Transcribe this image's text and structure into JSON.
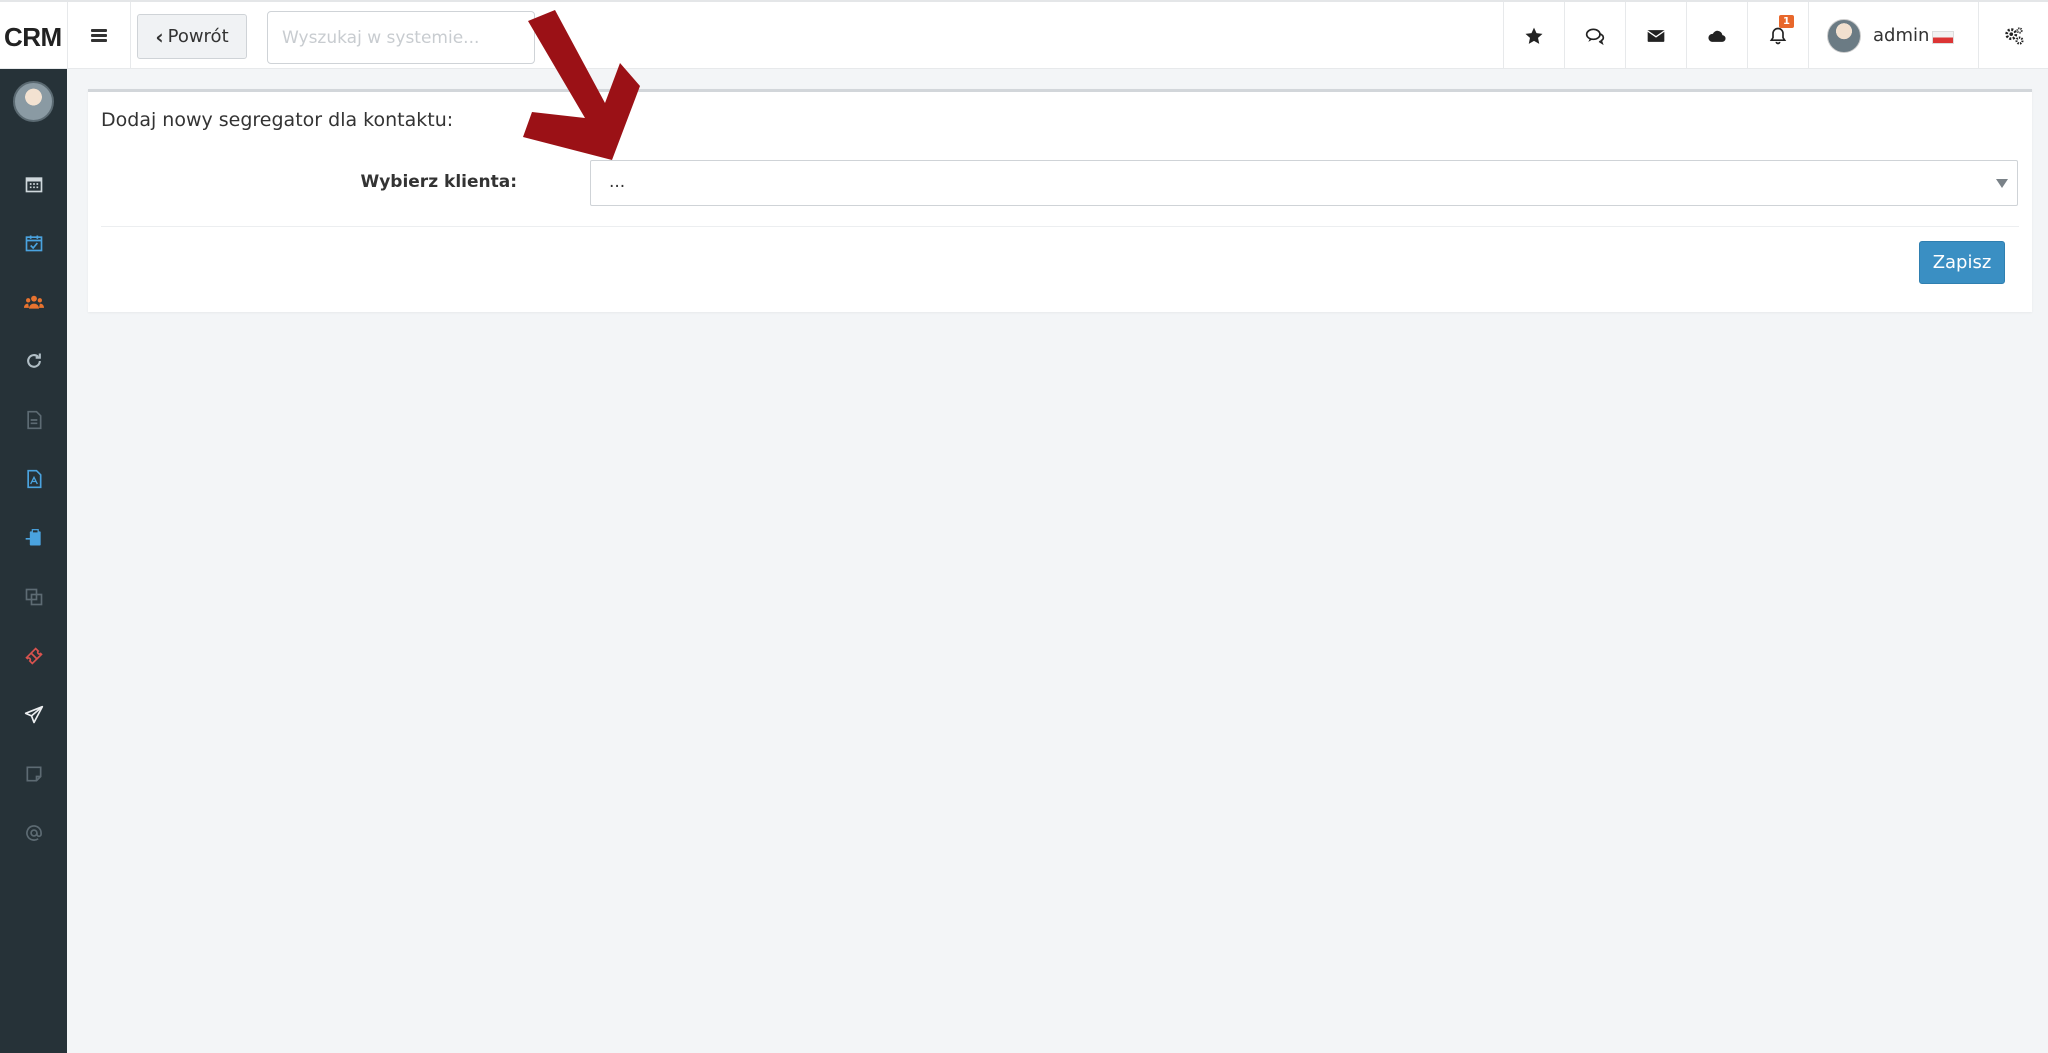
{
  "app": {
    "brand": "CRM"
  },
  "header": {
    "back_label": "Powrót",
    "search_placeholder": "Wyszukaj w systemie...",
    "notifications_count": "1",
    "user_name": "admin",
    "icons": [
      "star-icon",
      "comments-icon",
      "envelope-icon",
      "cloud-icon",
      "bell-icon",
      "settings-icon"
    ]
  },
  "sidebar": {
    "items": [
      {
        "icon": "calendar-icon",
        "color": "#cfd8dc"
      },
      {
        "icon": "calendar-check-icon",
        "color": "#4aa3df"
      },
      {
        "icon": "users-icon",
        "color": "#e8732f"
      },
      {
        "icon": "refresh-icon",
        "color": "#b0bec5"
      },
      {
        "icon": "document-icon",
        "color": "#5d6b73"
      },
      {
        "icon": "pdf-file-icon",
        "color": "#4aa3df"
      },
      {
        "icon": "clipboard-icon",
        "color": "#4aa3df"
      },
      {
        "icon": "copy-icon",
        "color": "#5d6b73"
      },
      {
        "icon": "ticket-icon",
        "color": "#d9534f"
      },
      {
        "icon": "paper-plane-icon",
        "color": "#eceff1"
      },
      {
        "icon": "note-icon",
        "color": "#5d6b73"
      },
      {
        "icon": "at-icon",
        "color": "#5d6b73"
      }
    ]
  },
  "form": {
    "title": "Dodaj nowy segregator dla kontaktu:",
    "client_label": "Wybierz klienta:",
    "client_value": "...",
    "save_label": "Zapisz"
  },
  "colors": {
    "sidebar_bg": "#263238",
    "primary": "#3a8fc3",
    "badge": "#e8672b",
    "annotation_arrow": "#9b1116"
  }
}
